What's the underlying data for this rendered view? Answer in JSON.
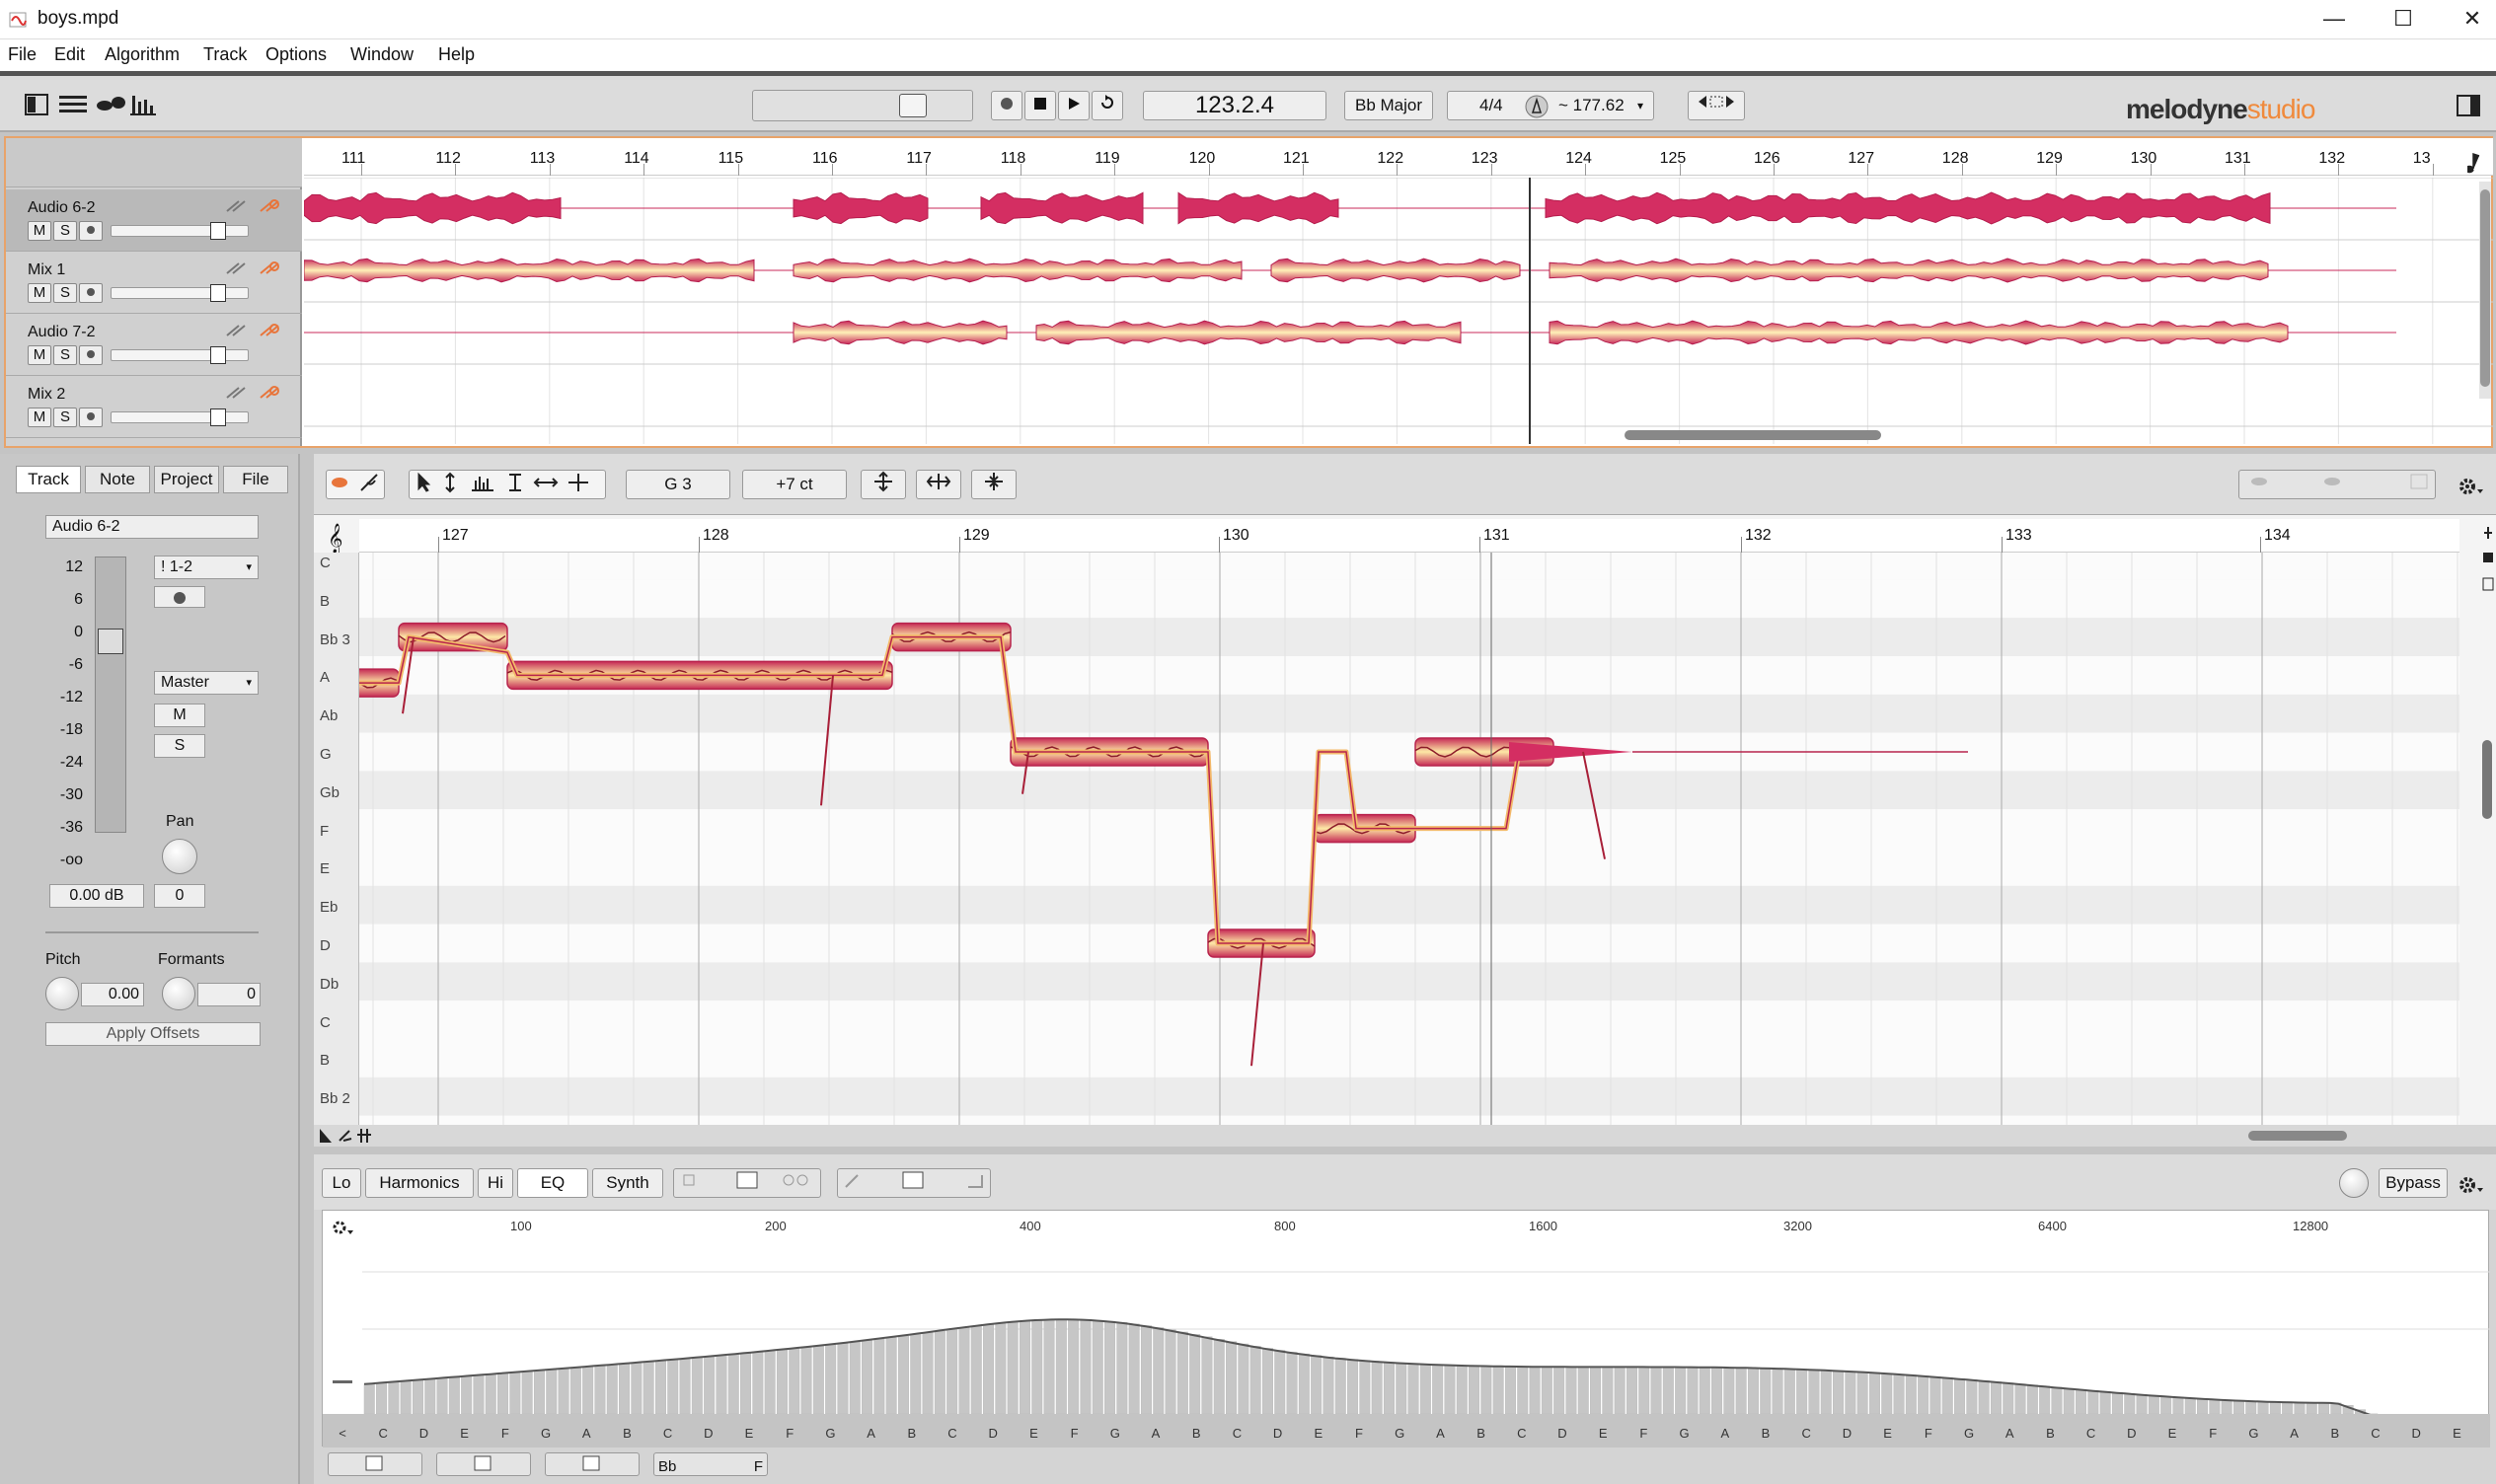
{
  "window": {
    "title": "boys.mpd"
  },
  "menu": [
    "File",
    "Edit",
    "Algorithm",
    "Track",
    "Options",
    "Window",
    "Help"
  ],
  "transport": {
    "position": "123.2.4",
    "key": "Bb Major",
    "time_signature": "4/4",
    "tempo": "~ 177.62"
  },
  "brand": {
    "name": "melodyne",
    "edition": "studio"
  },
  "tracks": [
    {
      "name": "Audio 6-2",
      "selected": true
    },
    {
      "name": "Mix 1",
      "selected": false
    },
    {
      "name": "Audio 7-2",
      "selected": false
    },
    {
      "name": "Mix 2",
      "selected": false
    }
  ],
  "track_buttons": {
    "mute": "M",
    "solo": "S"
  },
  "arrange_ruler": [
    "111",
    "112",
    "113",
    "114",
    "115",
    "116",
    "117",
    "118",
    "119",
    "120",
    "121",
    "122",
    "123",
    "124",
    "125",
    "126",
    "127",
    "128",
    "129",
    "130",
    "131",
    "132",
    "13"
  ],
  "inspector": {
    "tabs": [
      "Track",
      "Note",
      "Project",
      "File"
    ],
    "active_tab": "Track",
    "track_name": "Audio 6-2",
    "db_scale": [
      "12",
      "6",
      "0",
      "-6",
      "-12",
      "-18",
      "-24",
      "-30",
      "-36",
      "-oo"
    ],
    "channel": "! 1-2",
    "output": "Master",
    "mute": "M",
    "solo": "S",
    "pan_label": "Pan",
    "volume": "0.00 dB",
    "pan": "0",
    "pitch_label": "Pitch",
    "pitch": "0.00",
    "formants_label": "Formants",
    "formants": "0",
    "apply": "Apply Offsets"
  },
  "editor": {
    "pitch_display": "G 3",
    "cents_display": "+7 ct",
    "ruler": [
      "127",
      "128",
      "129",
      "130",
      "131",
      "132",
      "133",
      "134"
    ],
    "pitches": [
      "C",
      "B",
      "Bb 3",
      "A",
      "Ab",
      "G",
      "Gb",
      "F",
      "E",
      "Eb",
      "D",
      "Db",
      "C",
      "B",
      "Bb 2"
    ]
  },
  "sound_editor": {
    "tabs": [
      "Lo",
      "Harmonics",
      "Hi",
      "EQ",
      "Synth"
    ],
    "active_tab": "EQ",
    "bypass": "Bypass",
    "freqs": [
      "100",
      "200",
      "400",
      "800",
      "1600",
      "3200",
      "6400",
      "12800"
    ],
    "notes": [
      "<",
      "C",
      "D",
      "E",
      "F",
      "G",
      "A",
      "B",
      "C",
      "D",
      "E",
      "F",
      "G",
      "A",
      "B",
      "C",
      "D",
      "E",
      "F",
      "G",
      "A",
      "B",
      "C",
      "D",
      "E",
      "F",
      "G",
      "A",
      "B",
      "C",
      "D",
      "E",
      "F",
      "G",
      "A",
      "B",
      "C",
      "D",
      "E",
      "F",
      "G",
      "A",
      "B",
      "C",
      "D",
      "E",
      "F",
      "G",
      "A",
      "B",
      "C",
      "D",
      "E"
    ],
    "bottom_key": "Bb",
    "bottom_letter": "F"
  }
}
